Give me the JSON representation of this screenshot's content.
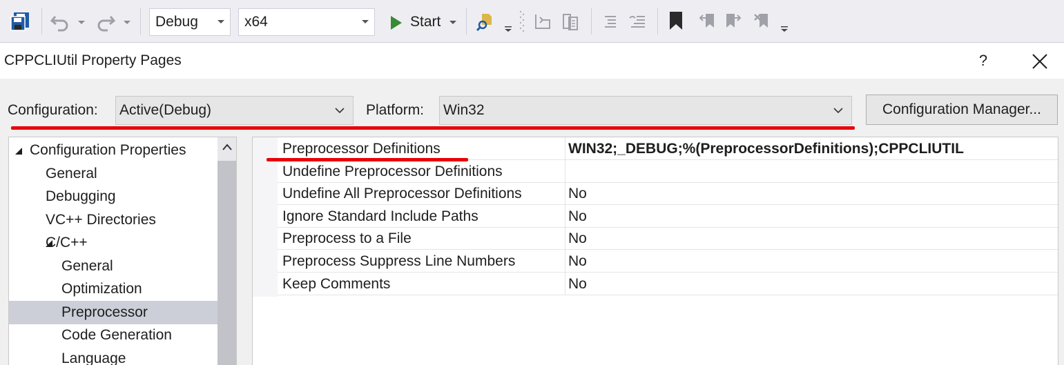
{
  "toolbar": {
    "config_combo": "Debug",
    "platform_combo": "x64",
    "start_label": "Start"
  },
  "dialog": {
    "title": "CPPCLIUtil Property Pages",
    "help": "?"
  },
  "config_row": {
    "configuration_label": "Configuration:",
    "configuration_value": "Active(Debug)",
    "platform_label": "Platform:",
    "platform_value": "Win32",
    "manager_button": "Configuration Manager..."
  },
  "tree": {
    "items": [
      {
        "label": "Configuration Properties",
        "level": 0,
        "expanded": true
      },
      {
        "label": "General",
        "level": 1
      },
      {
        "label": "Debugging",
        "level": 1
      },
      {
        "label": "VC++ Directories",
        "level": 1
      },
      {
        "label": "C/C++",
        "level": 1,
        "expanded": true
      },
      {
        "label": "General",
        "level": 2
      },
      {
        "label": "Optimization",
        "level": 2
      },
      {
        "label": "Preprocessor",
        "level": 2,
        "selected": true
      },
      {
        "label": "Code Generation",
        "level": 2
      },
      {
        "label": "Language",
        "level": 2
      }
    ]
  },
  "properties": {
    "rows": [
      {
        "name": "Preprocessor Definitions",
        "value": "WIN32;_DEBUG;%(PreprocessorDefinitions);CPPCLIUTIL",
        "bold": true
      },
      {
        "name": "Undefine Preprocessor Definitions",
        "value": ""
      },
      {
        "name": "Undefine All Preprocessor Definitions",
        "value": "No"
      },
      {
        "name": "Ignore Standard Include Paths",
        "value": "No"
      },
      {
        "name": "Preprocess to a File",
        "value": "No"
      },
      {
        "name": "Preprocess Suppress Line Numbers",
        "value": "No"
      },
      {
        "name": "Keep Comments",
        "value": "No"
      }
    ]
  },
  "colors": {
    "accent_red": "#e8000a",
    "start_green": "#388a34",
    "selected_row": "#ccced8"
  }
}
